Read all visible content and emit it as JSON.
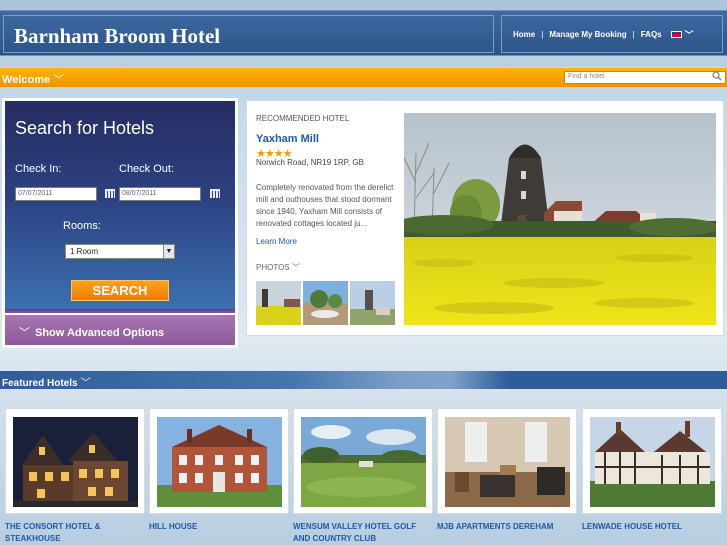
{
  "header": {
    "brand": "Barnham Broom Hotel",
    "nav": [
      {
        "label": "Home"
      },
      {
        "label": "Manage My Booking"
      },
      {
        "label": "FAQs"
      }
    ],
    "separator": "|",
    "language_icon": "uk-flag-icon"
  },
  "welcome_bar": {
    "label": "Welcome",
    "find_placeholder": "Find a hotel"
  },
  "search": {
    "title": "Search for Hotels",
    "check_in_label": "Check In:",
    "check_out_label": "Check Out:",
    "check_in_value": "07/07/2011",
    "check_out_value": "08/07/2011",
    "rooms_label": "Rooms:",
    "rooms_value": "1 Room",
    "button": "SEARCH",
    "advanced": "Show Advanced Options"
  },
  "recommended": {
    "caption": "RECOMMENDED HOTEL",
    "name": "Yaxham Mill",
    "stars": "★★★★",
    "address": "Norwich Road, NR19 1RP, GB",
    "description": "Completely renovated from the derelict mill and outhouses that stood dormant since 1940, Yaxham Mill consists of renovated cottages located ju...",
    "learn_more": "Learn More",
    "photos_label": "PHOTOS"
  },
  "featured": {
    "label": "Featured Hotels",
    "hotels": [
      {
        "name": "THE CONSORT HOTEL & STEAKHOUSE"
      },
      {
        "name": "HILL HOUSE"
      },
      {
        "name": "WENSUM VALLEY HOTEL GOLF AND COUNTRY CLUB"
      },
      {
        "name": "MJB APARTMENTS DEREHAM"
      },
      {
        "name": "LENWADE HOUSE HOTEL"
      }
    ]
  },
  "colors": {
    "header_blue": "#2c5488",
    "accent_orange": "#f29100",
    "link_blue": "#1e5aa8",
    "advanced_purple": "#8d5b9c"
  }
}
